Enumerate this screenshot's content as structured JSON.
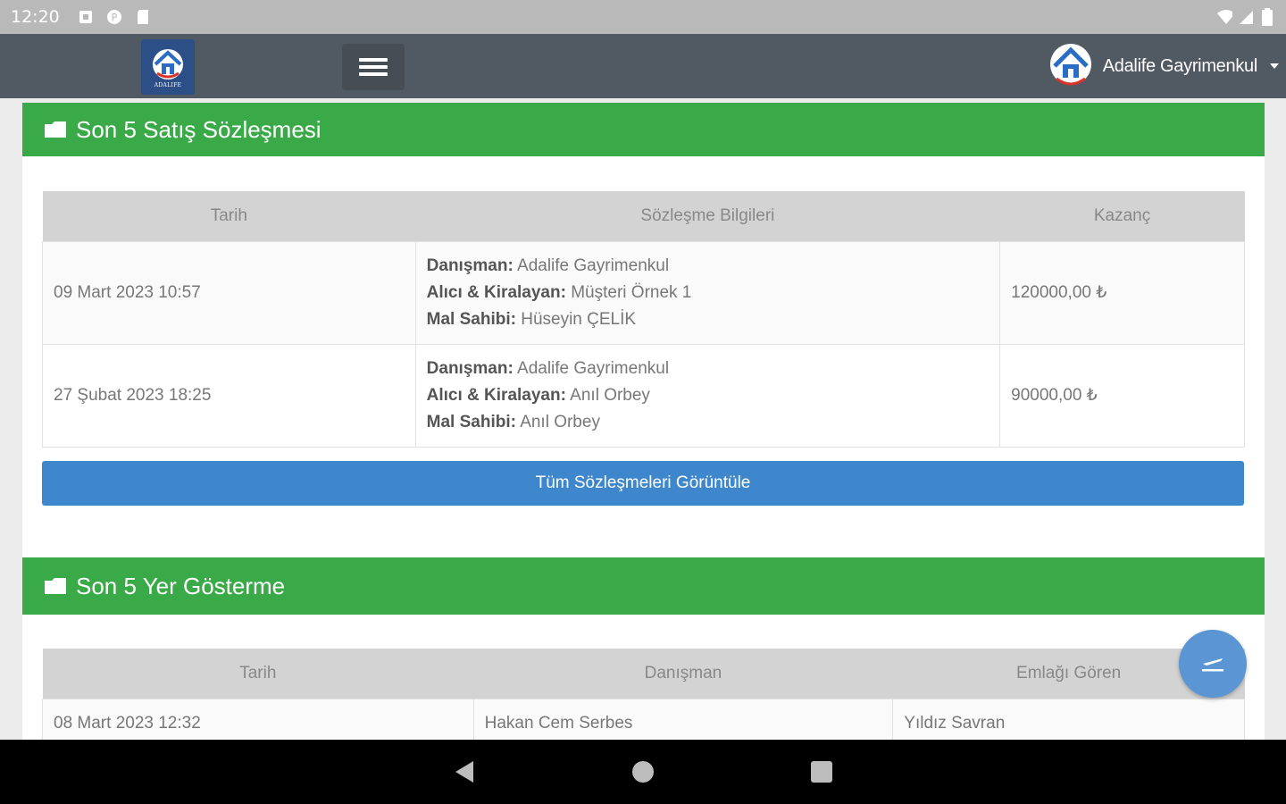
{
  "status_bar": {
    "time": "12:20"
  },
  "header": {
    "logo_text": "ADALIFE",
    "user_name": "Adalife Gayrimenkul"
  },
  "sales": {
    "title": "Son 5 Satış Sözleşmesi",
    "columns": [
      "Tarih",
      "Sözleşme Bilgileri",
      "Kazanç"
    ],
    "labels": {
      "advisor": "Danışman:",
      "buyer": "Alıcı & Kiralayan:",
      "owner": "Mal Sahibi:"
    },
    "rows": [
      {
        "date": "09 Mart 2023 10:57",
        "advisor": "Adalife Gayrimenkul",
        "buyer": "Müşteri Örnek 1",
        "owner": "Hüseyin ÇELİK",
        "earning": "120000,00 ₺"
      },
      {
        "date": "27 Şubat 2023 18:25",
        "advisor": "Adalife Gayrimenkul",
        "buyer": "Anıl Orbey",
        "owner": "Anıl Orbey",
        "earning": "90000,00 ₺"
      }
    ],
    "view_all_label": "Tüm Sözleşmeleri Görüntüle"
  },
  "showings": {
    "title": "Son 5 Yer Gösterme",
    "columns": [
      "Tarih",
      "Danışman",
      "Emlağı Gören"
    ],
    "rows": [
      {
        "date": "08 Mart 2023 12:32",
        "advisor": "Hakan Cem Serbes",
        "viewer": "Yıldız Savran"
      }
    ]
  },
  "colors": {
    "panel_header": "#3aaa48",
    "button": "#3f87cd",
    "app_header": "#515962"
  }
}
